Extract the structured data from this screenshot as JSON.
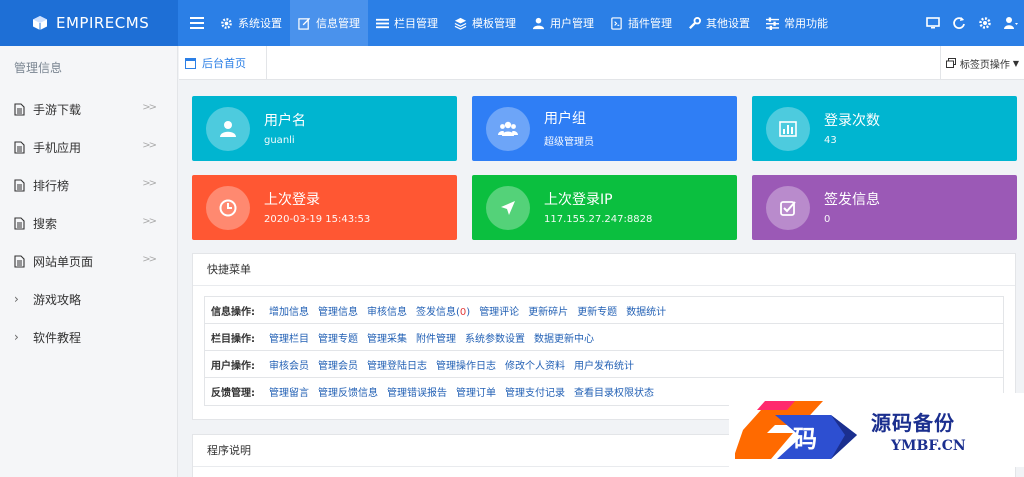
{
  "app": {
    "brand": "EMPIRECMS"
  },
  "nav": {
    "items": [
      {
        "label": "系统设置",
        "icon": "gear-icon"
      },
      {
        "label": "信息管理",
        "icon": "edit-icon",
        "active": true
      },
      {
        "label": "栏目管理",
        "icon": "list-icon"
      },
      {
        "label": "模板管理",
        "icon": "layers-icon"
      },
      {
        "label": "用户管理",
        "icon": "user-icon"
      },
      {
        "label": "插件管理",
        "icon": "plugin-icon"
      },
      {
        "label": "其他设置",
        "icon": "wrench-icon"
      },
      {
        "label": "常用功能",
        "icon": "sliders-icon"
      }
    ]
  },
  "sidebar": {
    "title": "管理信息",
    "items": [
      {
        "label": "手游下载",
        "icon": "document-icon",
        "expandable": true
      },
      {
        "label": "手机应用",
        "icon": "document-icon",
        "expandable": true
      },
      {
        "label": "排行榜",
        "icon": "document-icon",
        "expandable": true
      },
      {
        "label": "搜索",
        "icon": "document-icon",
        "expandable": true
      },
      {
        "label": "网站单页面",
        "icon": "document-icon",
        "expandable": true
      },
      {
        "label": "游戏攻略",
        "icon": "caret-right-icon",
        "expandable": false
      },
      {
        "label": "软件教程",
        "icon": "caret-right-icon",
        "expandable": false
      }
    ]
  },
  "tabs": {
    "home": "后台首页",
    "ops": "标签页操作"
  },
  "cards": [
    {
      "label": "用户名",
      "value": "guanli",
      "color": "#00b5d0",
      "icon": "user-icon"
    },
    {
      "label": "用户组",
      "value": "超级管理员",
      "color": "#2f7ef5",
      "icon": "users-icon"
    },
    {
      "label": "登录次数",
      "value": "43",
      "color": "#00b5d0",
      "icon": "bar-chart-icon"
    },
    {
      "label": "上次登录",
      "value": "2020-03-19 15:43:53",
      "color": "#ff5733",
      "icon": "clock-icon"
    },
    {
      "label": "上次登录IP",
      "value": "117.155.27.247:8828",
      "color": "#0bbf3f",
      "icon": "location-arrow-icon"
    },
    {
      "label": "签发信息",
      "value": "0",
      "color": "#9b59b6",
      "icon": "check-square-icon"
    }
  ],
  "quick_menu": {
    "title": "快捷菜单",
    "rows": [
      {
        "label": "信息操作:",
        "links": [
          "增加信息",
          "管理信息",
          "审核信息"
        ],
        "sign_prefix": "签发信息(",
        "sign_count": "0",
        "sign_suffix": ")",
        "links2": [
          "管理评论",
          "更新碎片",
          "更新专题",
          "数据统计"
        ]
      },
      {
        "label": "栏目操作:",
        "links": [
          "管理栏目",
          "管理专题",
          "管理采集",
          "附件管理",
          "系统参数设置",
          "数据更新中心"
        ]
      },
      {
        "label": "用户操作:",
        "links": [
          "审核会员",
          "管理会员",
          "管理登陆日志",
          "管理操作日志",
          "修改个人资料",
          "用户发布统计"
        ]
      },
      {
        "label": "反馈管理:",
        "links": [
          "管理留言",
          "管理反馈信息",
          "管理错误报告",
          "管理订单",
          "管理支付记录",
          "查看目录权限状态"
        ]
      }
    ]
  },
  "program_panel": {
    "title": "程序说明"
  },
  "watermark": {
    "cn": "源码备份",
    "en": "YMBF.CN",
    "logo_char": "码"
  }
}
